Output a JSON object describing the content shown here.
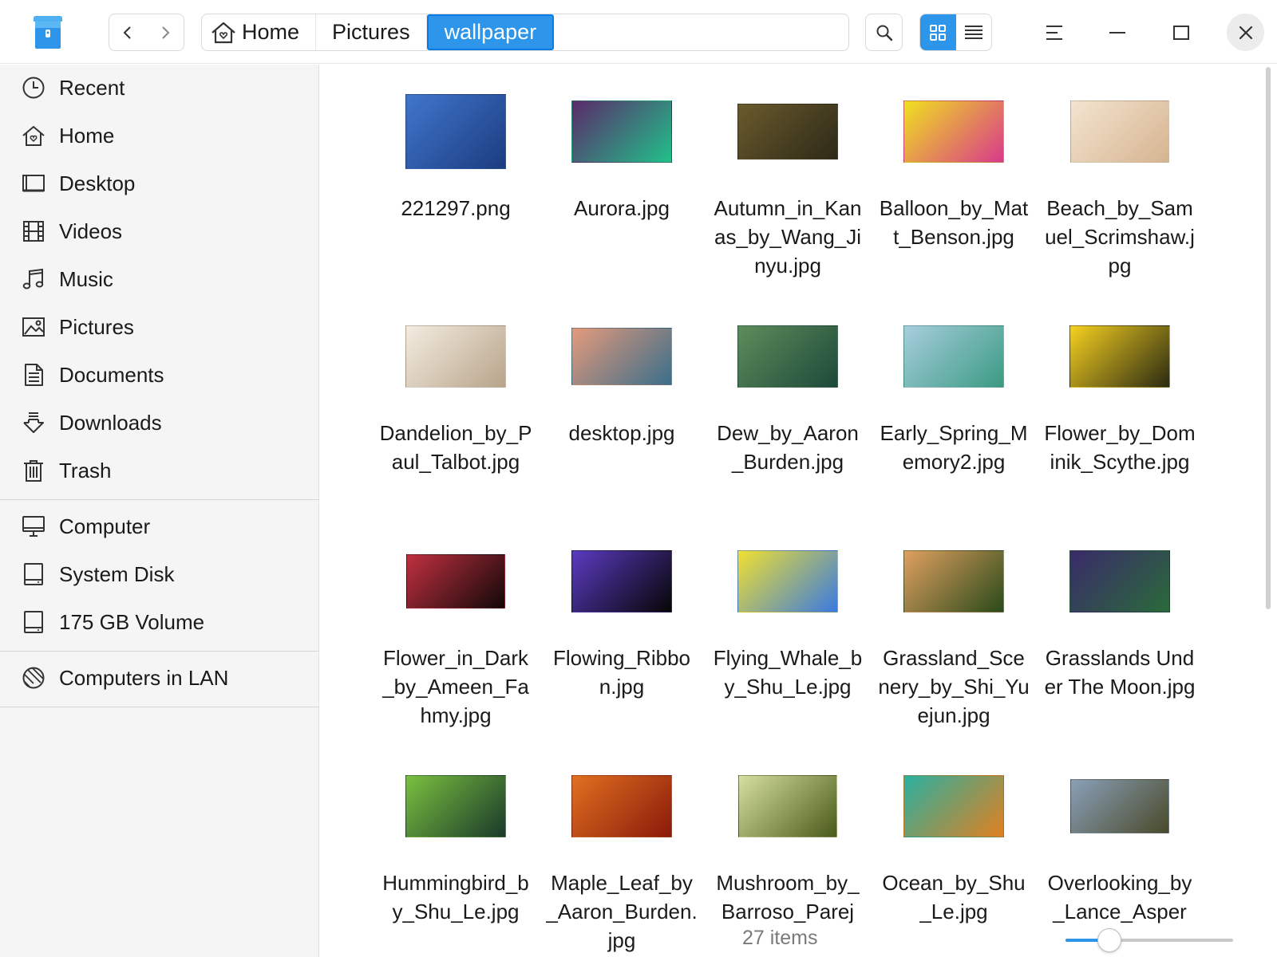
{
  "window": {
    "app_icon": "file-manager-icon",
    "nav": {
      "back_icon": "chevron-left-icon",
      "forward_icon": "chevron-right-icon"
    },
    "breadcrumb": [
      {
        "label": "Home",
        "icon": "home-icon"
      },
      {
        "label": "Pictures"
      },
      {
        "label": "wallpaper",
        "active": true
      }
    ],
    "toolbar": {
      "search_icon": "search-icon",
      "grid_view_icon": "grid-view-icon",
      "list_view_icon": "list-view-icon",
      "active_view": "grid",
      "menu_icon": "hamburger-menu-icon",
      "minimize_icon": "minimize-icon",
      "maximize_icon": "maximize-icon",
      "close_icon": "close-icon"
    }
  },
  "sidebar": {
    "groups": [
      [
        {
          "label": "Recent",
          "icon": "clock-icon"
        },
        {
          "label": "Home",
          "icon": "home-icon"
        },
        {
          "label": "Desktop",
          "icon": "desktop-icon"
        },
        {
          "label": "Videos",
          "icon": "film-icon"
        },
        {
          "label": "Music",
          "icon": "music-note-icon"
        },
        {
          "label": "Pictures",
          "icon": "image-icon"
        },
        {
          "label": "Documents",
          "icon": "document-icon"
        },
        {
          "label": "Downloads",
          "icon": "download-icon"
        },
        {
          "label": "Trash",
          "icon": "trash-icon"
        }
      ],
      [
        {
          "label": "Computer",
          "icon": "computer-icon"
        },
        {
          "label": "System Disk",
          "icon": "disk-icon"
        },
        {
          "label": "175 GB Volume",
          "icon": "disk-icon"
        }
      ],
      [
        {
          "label": "Computers in LAN",
          "icon": "network-icon"
        }
      ]
    ]
  },
  "files": [
    {
      "name": "221297.png",
      "colors": [
        "#4076cc",
        "#1c3c80"
      ]
    },
    {
      "name": "Aurora.jpg",
      "colors": [
        "#5a2a6a",
        "#22c08a"
      ]
    },
    {
      "name": "Autumn_in_Kanas_by_Wang_Jinyu.jpg",
      "colors": [
        "#6a5a2c",
        "#2e2a18"
      ]
    },
    {
      "name": "Balloon_by_Matt_Benson.jpg",
      "colors": [
        "#f0e020",
        "#d83a8a"
      ]
    },
    {
      "name": "Beach_by_Samuel_Scrimshaw.jpg",
      "colors": [
        "#f3e4d0",
        "#d6b490"
      ]
    },
    {
      "name": "Dandelion_by_Paul_Talbot.jpg",
      "colors": [
        "#f3ece0",
        "#b8a48a"
      ]
    },
    {
      "name": "desktop.jpg",
      "colors": [
        "#e49a7c",
        "#3a6e8a"
      ]
    },
    {
      "name": "Dew_by_Aaron_Burden.jpg",
      "colors": [
        "#5f8c5a",
        "#1c4a3a"
      ]
    },
    {
      "name": "Early_Spring_Memory2.jpg",
      "colors": [
        "#a8cede",
        "#3a9a82"
      ]
    },
    {
      "name": "Flower_by_Dominik_Scythe.jpg",
      "colors": [
        "#f6d020",
        "#2a2a12"
      ]
    },
    {
      "name": "Flower_in_Dark_by_Ameen_Fahmy.jpg",
      "colors": [
        "#c03040",
        "#120808"
      ]
    },
    {
      "name": "Flowing_Ribbon.jpg",
      "colors": [
        "#5a3ac0",
        "#060606"
      ]
    },
    {
      "name": "Flying_Whale_by_Shu_Le.jpg",
      "colors": [
        "#f0e030",
        "#3a7ae0"
      ]
    },
    {
      "name": "Grassland_Scenery_by_Shi_Yuejun.jpg",
      "colors": [
        "#e0a060",
        "#2a4a1a"
      ]
    },
    {
      "name": "Grasslands Under The Moon.jpg",
      "colors": [
        "#3a2a6a",
        "#2a6a3a"
      ]
    },
    {
      "name": "Hummingbird_by_Shu_Le.jpg",
      "colors": [
        "#7ac040",
        "#1a3a2a"
      ]
    },
    {
      "name": "Maple_Leaf_by_Aaron_Burden.jpg",
      "colors": [
        "#e07020",
        "#8a1a0a"
      ]
    },
    {
      "name": "Mushroom_by_Barroso_Parej",
      "colors": [
        "#d6e0a0",
        "#4a5a1a"
      ]
    },
    {
      "name": "Ocean_by_Shu_Le.jpg",
      "colors": [
        "#2ab0a0",
        "#e08020"
      ]
    },
    {
      "name": "Overlooking_by_Lance_Asper",
      "colors": [
        "#8aa0b8",
        "#4a4a2a"
      ]
    }
  ],
  "status": {
    "item_count": "27 items",
    "zoom_fraction": 0.26
  }
}
